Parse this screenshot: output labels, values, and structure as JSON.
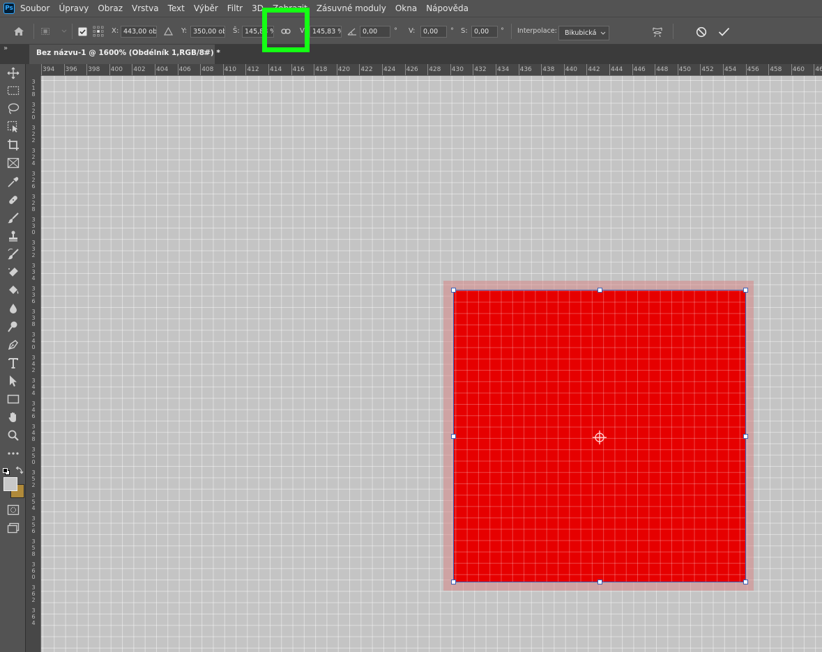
{
  "app": {
    "logo_text": "Ps"
  },
  "menu": [
    "Soubor",
    "Úpravy",
    "Obraz",
    "Vrstva",
    "Text",
    "Výběr",
    "Filtr",
    "3D",
    "Zobrazit",
    "Zásuvné moduly",
    "Okna",
    "Nápověda"
  ],
  "options": {
    "x_label": "X:",
    "x_value": "443,00 ob",
    "y_label": "Y:",
    "y_value": "350,00 ob",
    "w_label": "Š:",
    "w_value": "145,83 %",
    "h_label": "V:",
    "h_value": "145,83 %",
    "angle_value": "0,00",
    "angle_unit": "°",
    "hskew_label": "V:",
    "hskew_value": "0,00",
    "hskew_unit": "°",
    "vskew_label": "S:",
    "vskew_value": "0,00",
    "vskew_unit": "°",
    "interp_label": "Interpolace:",
    "interp_value": "Bikubická"
  },
  "tabs": {
    "panel_toggle": "»",
    "document_title": "Bez názvu-1 @ 1600% (Obdélník 1,RGB/8#) *",
    "close": "×"
  },
  "rulers": {
    "horizontal": [
      "394",
      "396",
      "398",
      "400",
      "402",
      "404",
      "406",
      "408",
      "410",
      "412",
      "414",
      "416",
      "418",
      "420",
      "422",
      "424",
      "426",
      "428",
      "430",
      "432",
      "434",
      "436",
      "438",
      "440",
      "442",
      "444",
      "446",
      "448",
      "450",
      "452",
      "454",
      "456",
      "458",
      "460",
      "462"
    ],
    "vertical": [
      "318",
      "320",
      "322",
      "324",
      "326",
      "328",
      "330",
      "332",
      "334",
      "336",
      "338",
      "340",
      "342",
      "344",
      "346",
      "348",
      "350",
      "352",
      "354",
      "356",
      "358",
      "360",
      "362",
      "364"
    ]
  },
  "colors": {
    "shape_fill": "#e60000",
    "highlight": "#14ff14",
    "foreground_swatch": "#c8c8c8",
    "background_swatch": "#b08a3a"
  }
}
